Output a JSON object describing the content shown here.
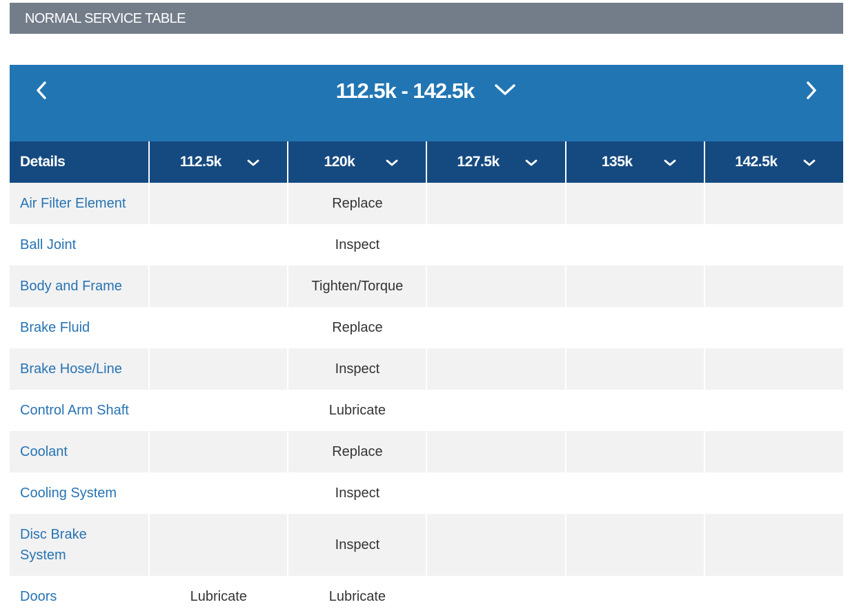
{
  "section": {
    "title": "NORMAL SERVICE TABLE"
  },
  "range": {
    "label": "112.5k - 142.5k",
    "prev_icon": "chevron-left-icon",
    "next_icon": "chevron-right-icon",
    "dropdown_icon": "chevron-down-icon"
  },
  "table": {
    "details_header": "Details",
    "columns": [
      "112.5k",
      "120k",
      "127.5k",
      "135k",
      "142.5k"
    ],
    "rows": [
      {
        "item": "Air Filter Element",
        "cells": [
          "",
          "Replace",
          "",
          "",
          ""
        ]
      },
      {
        "item": "Ball Joint",
        "cells": [
          "",
          "Inspect",
          "",
          "",
          ""
        ]
      },
      {
        "item": "Body and Frame",
        "cells": [
          "",
          "Tighten/Torque",
          "",
          "",
          ""
        ]
      },
      {
        "item": "Brake Fluid",
        "cells": [
          "",
          "Replace",
          "",
          "",
          ""
        ]
      },
      {
        "item": "Brake Hose/Line",
        "cells": [
          "",
          "Inspect",
          "",
          "",
          ""
        ]
      },
      {
        "item": "Control Arm Shaft",
        "cells": [
          "",
          "Lubricate",
          "",
          "",
          ""
        ]
      },
      {
        "item": "Coolant",
        "cells": [
          "",
          "Replace",
          "",
          "",
          ""
        ]
      },
      {
        "item": "Cooling System",
        "cells": [
          "",
          "Inspect",
          "",
          "",
          ""
        ]
      },
      {
        "item": "Disc Brake System",
        "cells": [
          "",
          "Inspect",
          "",
          "",
          ""
        ]
      },
      {
        "item": "Doors",
        "cells": [
          "Lubricate",
          "Lubricate",
          "",
          "",
          ""
        ]
      }
    ]
  },
  "colors": {
    "section_header_bg": "#737d8a",
    "range_bar_bg": "#2175b3",
    "column_header_bg": "#154a80",
    "item_link": "#2673b3",
    "row_shade": "#f2f2f2"
  }
}
